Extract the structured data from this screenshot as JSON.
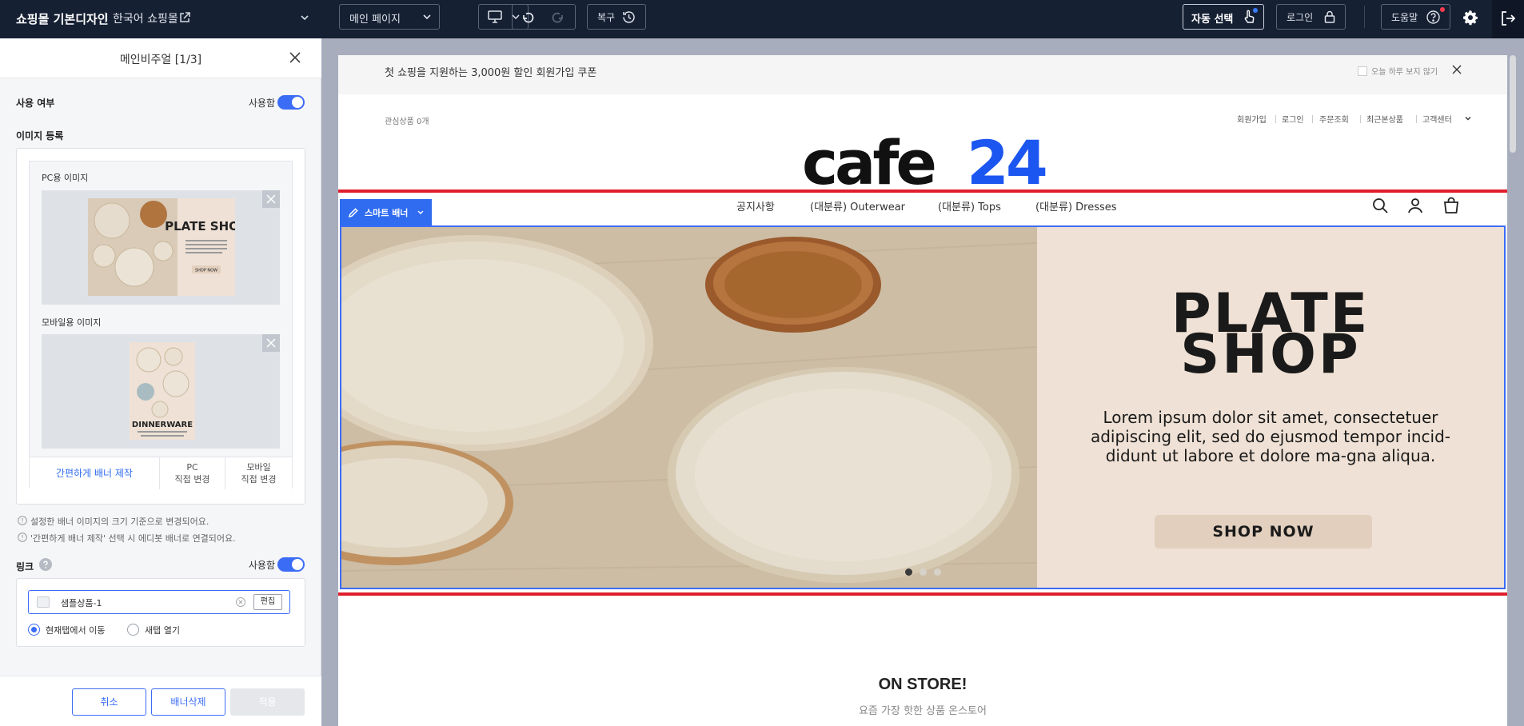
{
  "topbar": {
    "title": "쇼핑몰 기본디자인",
    "shop": "한국어 쇼핑몰",
    "page_select": "메인 페이지",
    "restore": "복구",
    "auto_select": "자동 선택",
    "login": "로그인",
    "help": "도움말"
  },
  "panel": {
    "title": "메인비주얼 [1/3]",
    "use_label": "사용 여부",
    "use_toggle_text": "사용함",
    "image_section": "이미지 등록",
    "pc_image_label": "PC용 이미지",
    "mobile_image_label": "모바일용 이미지",
    "thumb_pc_title": "PLATE SHOP",
    "thumb_mobile_title": "DINNERWARE",
    "thumb_cta": "SHOP NOW",
    "actions": {
      "easy": "간편하게 배너 제작",
      "pc_line1": "PC",
      "pc_line2": "직접 변경",
      "mobile_line1": "모바일",
      "mobile_line2": "직접 변경"
    },
    "notes": [
      "설정한 배너 이미지의 크기 기준으로 변경되어요.",
      "'간편하게 배너 제작' 선택 시 에디봇 배너로 연결되어요."
    ],
    "link_label": "링크",
    "link_toggle_text": "사용함",
    "link_value": "샘플상품-1",
    "link_edit": "편집",
    "radio_current": "현재탭에서 이동",
    "radio_new": "새탭 열기",
    "buttons": {
      "cancel": "취소",
      "delete": "배너삭제",
      "apply": "적용"
    }
  },
  "preview": {
    "promo_text": "첫 쇼핑을 지원하는 3,000원 할인 회원가입 쿠폰",
    "promo_option": "오늘 하루 보지 않기",
    "wishlist": "관심상품 0개",
    "util_links": [
      "회원가입",
      "로그인",
      "주문조회",
      "최근본상품",
      "고객센터"
    ],
    "logo_dark": "cafe",
    "logo_blue": "24",
    "smart_banner": "스마트 배너",
    "gnb": [
      "공지사항",
      "(대분류) Outerwear",
      "(대분류) Tops",
      "(대분류) Dresses"
    ],
    "banner": {
      "title_line1": "PLATE",
      "title_line2": "SHOP",
      "body": "Lorem ipsum dolor sit amet, consectetuer adipiscing elit, sed do ejusmod tempor incid-didunt ut labore et dolore ma-gna aliqua.",
      "cta": "SHOP NOW",
      "slide_count": 3,
      "active_slide": 1
    },
    "store_title": "ON STORE!",
    "store_subtitle": "요즘 가장 핫한 상품 온스토어"
  },
  "colors": {
    "topbar_bg": "#152033",
    "accent_blue": "#3b6cf5",
    "highlight_red": "#e01e2b",
    "banner_beige": "#efe1d5"
  }
}
